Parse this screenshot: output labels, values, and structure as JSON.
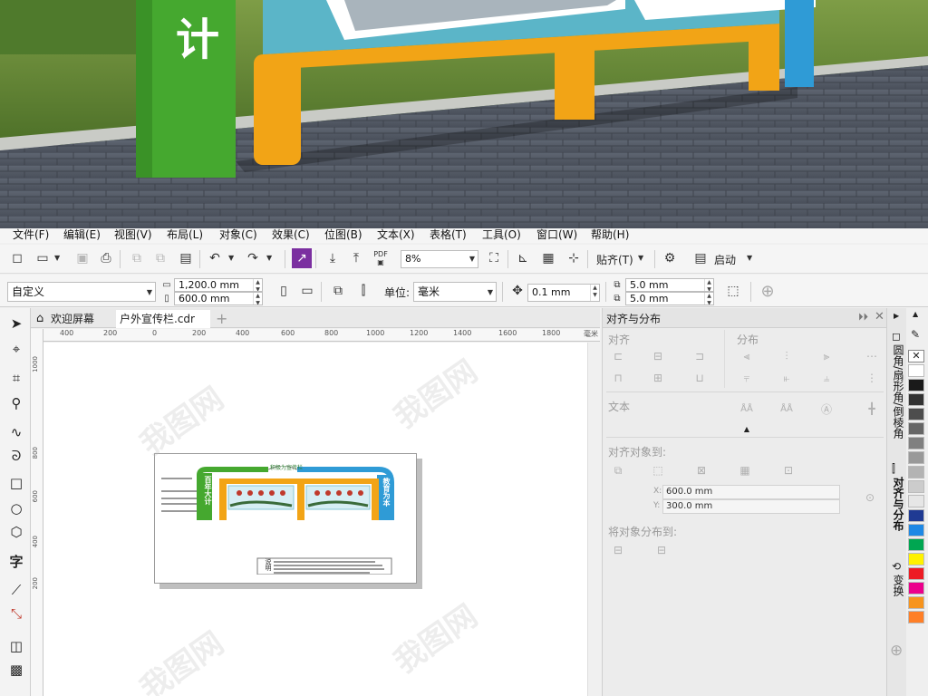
{
  "menubar": {
    "items": [
      "文件(F)",
      "编辑(E)",
      "视图(V)",
      "布局(L)",
      "对象(C)",
      "效果(C)",
      "位图(B)",
      "文本(X)",
      "表格(T)",
      "工具(O)",
      "窗口(W)",
      "帮助(H)"
    ]
  },
  "toolbar1": {
    "pdf_label": "PDF",
    "zoom_value": "8%",
    "snap_label": "贴齐(T)",
    "launch_label": "启动"
  },
  "toolbar2": {
    "page_preset": "自定义",
    "width_value": "1,200.0 mm",
    "height_value": "600.0 mm",
    "units_label": "单位:",
    "units_value": "毫米",
    "nudge_value": "0.1 mm",
    "dup_x_value": "5.0 mm",
    "dup_y_value": "5.0 mm"
  },
  "doc_tabs": {
    "welcome_label": "欢迎屏幕",
    "file_label": "户外宣传栏.cdr",
    "add_label": "+"
  },
  "ruler": {
    "h_ticks": [
      "400",
      "200",
      "0",
      "200",
      "400",
      "600",
      "800",
      "1000",
      "1200",
      "1400",
      "1600",
      "1800"
    ],
    "unit": "毫米",
    "v_ticks": [
      "1000",
      "800",
      "600",
      "400",
      "200"
    ]
  },
  "docker": {
    "title": "对齐与分布",
    "align_label": "对齐",
    "distribute_label": "分布",
    "text_label": "文本",
    "align_to_label": "对齐对象到:",
    "x_value": "600.0 mm",
    "y_value": "300.0 mm",
    "distribute_to_label": "将对象分布到:"
  },
  "right_tabs": {
    "tab1": "圆角/扇形角/倒棱角",
    "tab2": "对齐与分布",
    "tab3": "变换"
  },
  "artwork": {
    "top_banner": "积极为宣传栏",
    "left_text": "百年大计",
    "right_text": "教育为本",
    "notes_label": "说明",
    "photo_sign_text": "计"
  },
  "palette_colors": [
    "#ffffff",
    "#1a1a1a",
    "#333333",
    "#4d4d4d",
    "#666666",
    "#808080",
    "#999999",
    "#b3b3b3",
    "#cccccc",
    "#e6e6e6",
    "#1f3a93",
    "#1e88e5",
    "#00a651",
    "#fff200",
    "#ed1c24",
    "#ec008c",
    "#f7941d",
    "#ff7f27"
  ],
  "watermark": "我图网"
}
